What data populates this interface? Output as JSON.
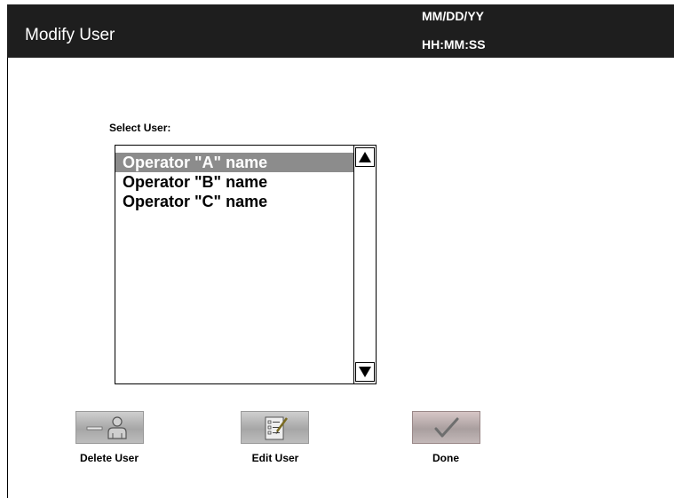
{
  "header": {
    "title": "Modify User",
    "date": "MM/DD/YY",
    "time": "HH:MM:SS"
  },
  "select_user": {
    "label": "Select User:",
    "items": [
      {
        "label": "Operator \"A\" name",
        "selected": true
      },
      {
        "label": "Operator \"B\" name",
        "selected": false
      },
      {
        "label": "Operator \"C\" name",
        "selected": false
      }
    ]
  },
  "actions": {
    "delete_label": "Delete User",
    "edit_label": "Edit User",
    "done_label": "Done"
  },
  "icons": {
    "delete": "remove-user-icon",
    "edit": "edit-checklist-icon",
    "done": "checkmark-icon",
    "scroll_up": "triangle-up-icon",
    "scroll_down": "triangle-down-icon"
  },
  "colors": {
    "header_bg": "#1e1e1e",
    "selected_bg": "#8c8c8c"
  }
}
